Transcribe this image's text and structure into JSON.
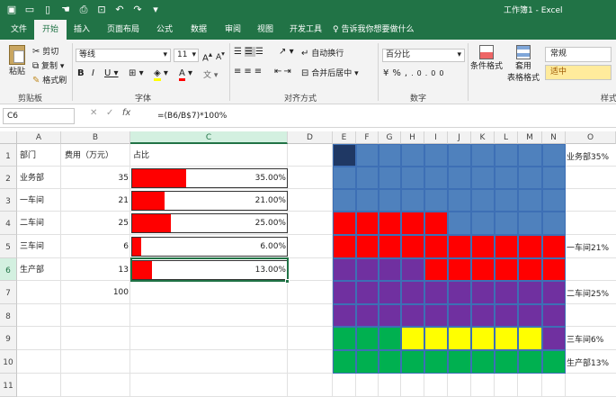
{
  "window": {
    "title": "工作簿1 - Excel"
  },
  "tabs": [
    "文件",
    "开始",
    "插入",
    "页面布局",
    "公式",
    "数据",
    "审阅",
    "视图",
    "开发工具"
  ],
  "active_tab": "开始",
  "tell_me": "告诉我你想要做什么",
  "ribbon": {
    "clipboard": {
      "paste": "粘贴",
      "cut": "剪切",
      "copy": "复制",
      "format_painter": "格式刷",
      "label": "剪贴板"
    },
    "font": {
      "name": "等线",
      "size": "11",
      "label": "字体"
    },
    "alignment": {
      "wrap": "自动换行",
      "merge": "合并后居中",
      "label": "对齐方式"
    },
    "number": {
      "format": "百分比",
      "label": "数字"
    },
    "styles": {
      "conditional": "条件格式",
      "table": "套用",
      "table2": "表格格式",
      "normal": "常规",
      "neutral": "适中",
      "label": "样式"
    }
  },
  "formula_bar": {
    "name_box": "C6",
    "fx": "fx",
    "formula": "=(B6/B$7)*100%"
  },
  "columns": [
    "A",
    "B",
    "C",
    "D",
    "E",
    "F",
    "G",
    "H",
    "I",
    "J",
    "K",
    "L",
    "M",
    "N",
    "O"
  ],
  "rows": [
    "1",
    "2",
    "3",
    "4",
    "5",
    "6",
    "7",
    "8",
    "9",
    "10",
    "11"
  ],
  "sheet": {
    "header": {
      "a": "部门",
      "b": "费用（万元）",
      "c": "占比"
    },
    "data": [
      {
        "dept": "业务部",
        "cost": "35",
        "pct": "35.00%",
        "frac": 0.35
      },
      {
        "dept": "一车间",
        "cost": "21",
        "pct": "21.00%",
        "frac": 0.21
      },
      {
        "dept": "二车间",
        "cost": "25",
        "pct": "25.00%",
        "frac": 0.25
      },
      {
        "dept": "三车间",
        "cost": "6",
        "pct": "6.00%",
        "frac": 0.06
      },
      {
        "dept": "生产部",
        "cost": "13",
        "pct": "13.00%",
        "frac": 0.13
      }
    ],
    "total": "100"
  },
  "waffle": {
    "colors": {
      "blue": "#4f81bd",
      "darkblue": "#1f3864",
      "red": "#ff0000",
      "purple": "#7030a0",
      "yellow": "#ffff00",
      "green": "#00b050"
    },
    "labels": [
      "业务部35%",
      "一车间21%",
      "二车间25%",
      "三车间6%",
      "生产部13%"
    ]
  },
  "colors": {
    "accent": "#217346",
    "databar": "#ff0000"
  }
}
